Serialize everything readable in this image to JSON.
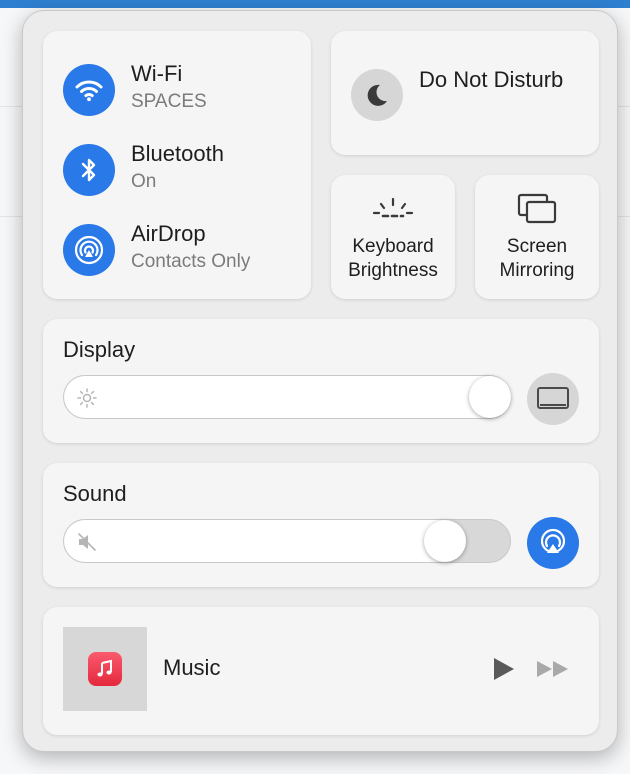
{
  "colors": {
    "accent": "#2a79e8",
    "panel_bg": "#ececec",
    "tile_bg": "#f5f5f5",
    "inactive_circle": "#d6d6d6",
    "music_red": "#e4283d"
  },
  "connectivity": {
    "wifi": {
      "title": "Wi-Fi",
      "subtitle": "SPACES",
      "icon": "wifi-icon",
      "active": true
    },
    "bluetooth": {
      "title": "Bluetooth",
      "subtitle": "On",
      "icon": "bluetooth-icon",
      "active": true
    },
    "airdrop": {
      "title": "AirDrop",
      "subtitle": "Contacts Only",
      "icon": "airdrop-icon",
      "active": true
    }
  },
  "do_not_disturb": {
    "label": "Do Not Disturb",
    "icon": "moon-icon",
    "active": false
  },
  "keyboard_brightness": {
    "label": "Keyboard Brightness",
    "icon": "keyboard-brightness-icon"
  },
  "screen_mirroring": {
    "label": "Screen Mirroring",
    "icon": "screen-mirroring-icon"
  },
  "display": {
    "title": "Display",
    "brightness_fraction": 1.0,
    "icon": "sun-icon",
    "side_button_icon": "display-icon"
  },
  "sound": {
    "title": "Sound",
    "volume_fraction": 0.89,
    "icon": "speaker-muted-icon",
    "side_button_icon": "airplay-audio-icon"
  },
  "now_playing": {
    "app": "Music",
    "app_icon": "music-note-icon",
    "play_icon": "play-icon",
    "next_icon": "fast-forward-icon"
  }
}
